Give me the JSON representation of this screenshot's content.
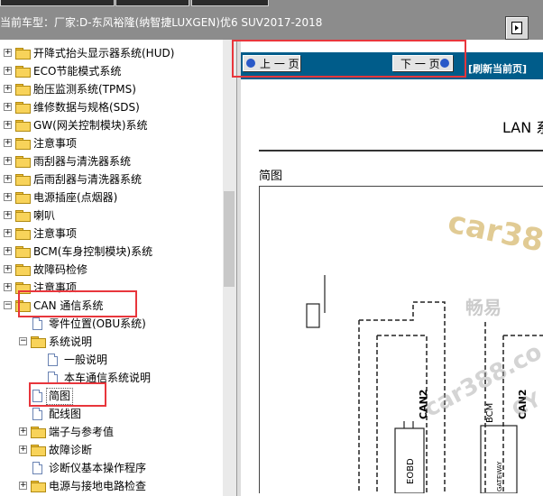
{
  "header": {
    "vehicle_label": "当前车型：",
    "vehicle_value": "厂家:D-东风裕隆(纳智捷LUXGEN)优6 SUV2017-2018"
  },
  "tree": {
    "items": [
      {
        "label": "开降式抬头显示器系统(HUD)",
        "level": 0,
        "type": "folder",
        "expander": "+"
      },
      {
        "label": "ECO节能模式系统",
        "level": 0,
        "type": "folder",
        "expander": "+"
      },
      {
        "label": "胎压监测系统(TPMS)",
        "level": 0,
        "type": "folder",
        "expander": "+"
      },
      {
        "label": "维修数据与规格(SDS)",
        "level": 0,
        "type": "folder",
        "expander": "+"
      },
      {
        "label": "GW(网关控制模块)系统",
        "level": 0,
        "type": "folder",
        "expander": "+"
      },
      {
        "label": "注意事项",
        "level": 0,
        "type": "folder",
        "expander": "+"
      },
      {
        "label": "雨刮器与清洗器系统",
        "level": 0,
        "type": "folder",
        "expander": "+"
      },
      {
        "label": "后雨刮器与清洗器系统",
        "level": 0,
        "type": "folder",
        "expander": "+"
      },
      {
        "label": "电源插座(点烟器)",
        "level": 0,
        "type": "folder",
        "expander": "+"
      },
      {
        "label": "喇叭",
        "level": 0,
        "type": "folder",
        "expander": "+"
      },
      {
        "label": "注意事项",
        "level": 0,
        "type": "folder",
        "expander": "+"
      },
      {
        "label": "BCM(车身控制模块)系统",
        "level": 0,
        "type": "folder",
        "expander": "+"
      },
      {
        "label": "故障码检修",
        "level": 0,
        "type": "folder",
        "expander": "+"
      },
      {
        "label": "注意事项",
        "level": 0,
        "type": "folder",
        "expander": "+"
      },
      {
        "label": "CAN 通信系统",
        "level": 0,
        "type": "folder",
        "expander": "-"
      },
      {
        "label": "零件位置(OBU系统)",
        "level": 1,
        "type": "doc",
        "expander": ""
      },
      {
        "label": "系统说明",
        "level": 1,
        "type": "folder",
        "expander": "-"
      },
      {
        "label": "一般说明",
        "level": 2,
        "type": "doc",
        "expander": ""
      },
      {
        "label": "本车通信系统说明",
        "level": 2,
        "type": "doc",
        "expander": ""
      },
      {
        "label": "简图",
        "level": 1,
        "type": "doc",
        "expander": "",
        "selected": true
      },
      {
        "label": "配线图",
        "level": 1,
        "type": "doc",
        "expander": ""
      },
      {
        "label": "端子与参考值",
        "level": 1,
        "type": "folder",
        "expander": "+"
      },
      {
        "label": "故障诊断",
        "level": 1,
        "type": "folder",
        "expander": "+"
      },
      {
        "label": "诊断仪基本操作程序",
        "level": 1,
        "type": "doc",
        "expander": ""
      },
      {
        "label": "电源与接地电路检查",
        "level": 1,
        "type": "folder",
        "expander": "+"
      }
    ]
  },
  "nav": {
    "prev_label": "上 一 页",
    "next_label": "下 一 页",
    "refresh_label": "[刷新当前页]"
  },
  "document": {
    "title": "LAN 系",
    "section_label": "简图",
    "watermark_main": "car38",
    "watermark_cn": "畅易",
    "watermark_url": "car388.co",
    "watermark_url2": "CY",
    "diagram_labels": {
      "can2_a": "CAN2",
      "can2_b": "CAN2",
      "bcm": "BCM",
      "eobd": "EOBD",
      "gateway": "GATEWAY"
    }
  },
  "colors": {
    "accent": "#005c8a",
    "highlight": "#e8363c",
    "folder": "#f8d35a"
  }
}
